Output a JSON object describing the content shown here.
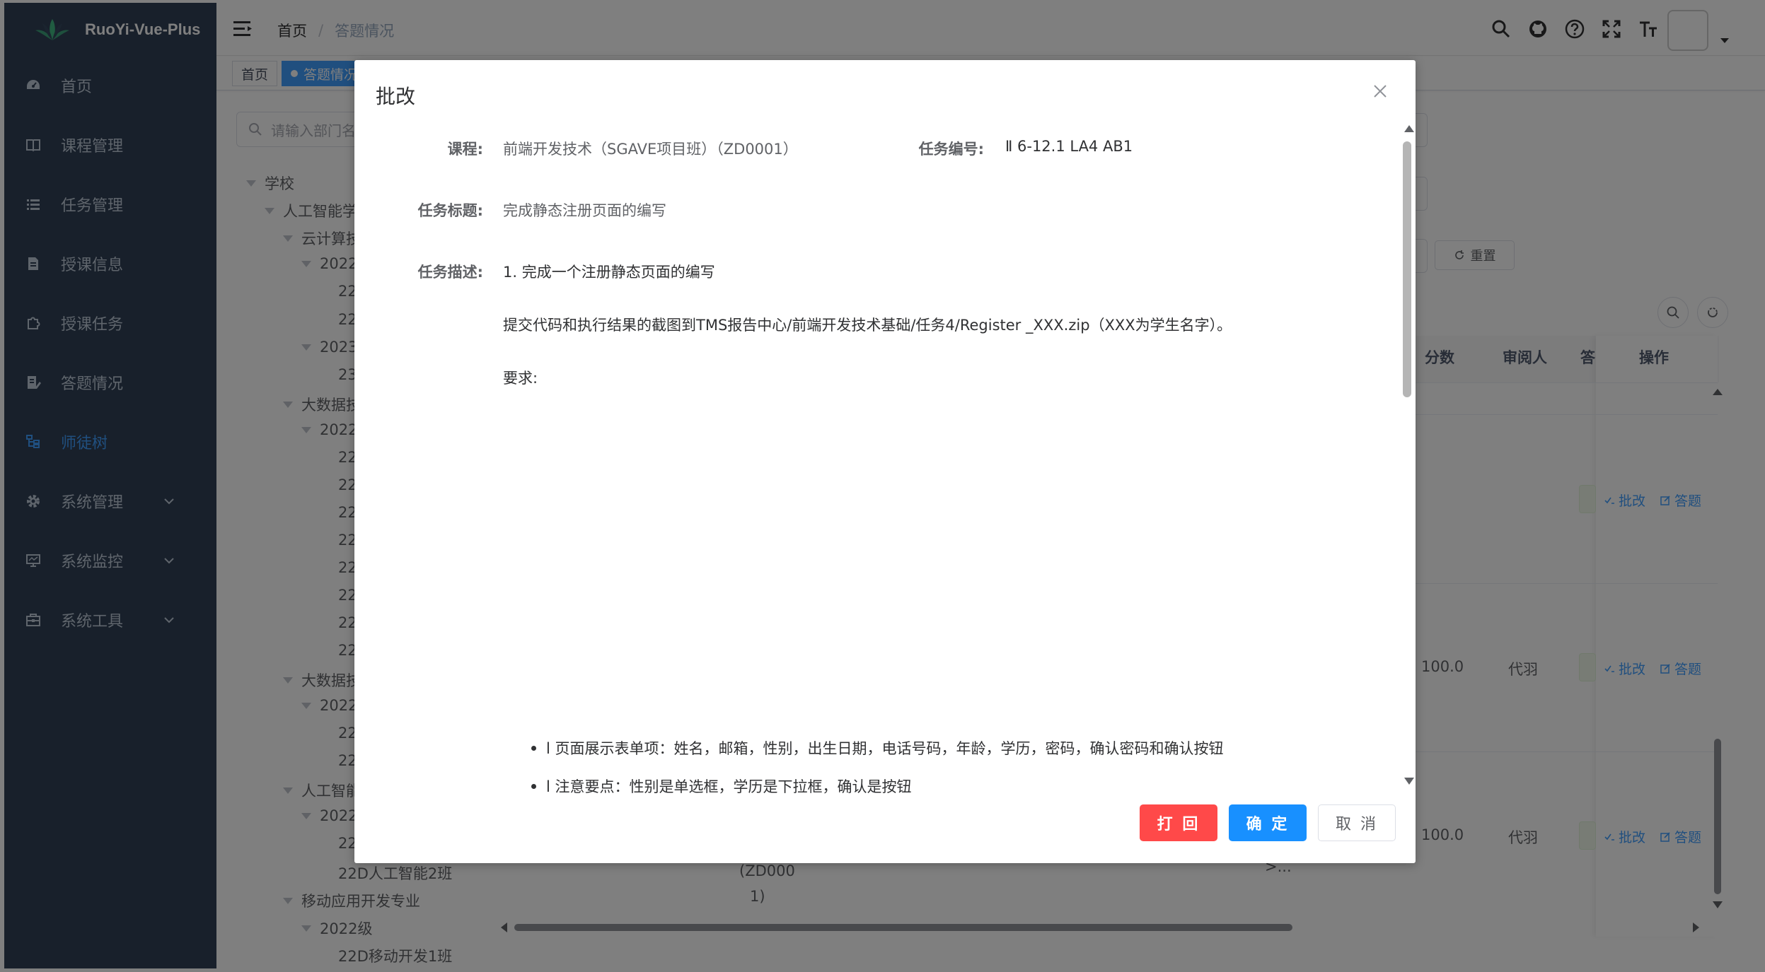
{
  "app": {
    "name": "RuoYi-Vue-Plus"
  },
  "sidebar": {
    "items": [
      {
        "label": "首页",
        "icon": "dashboard-icon"
      },
      {
        "label": "课程管理",
        "icon": "book-icon"
      },
      {
        "label": "任务管理",
        "icon": "list-icon"
      },
      {
        "label": "授课信息",
        "icon": "document-icon"
      },
      {
        "label": "授课任务",
        "icon": "puzzle-icon"
      },
      {
        "label": "答题情况",
        "icon": "edit-doc-icon"
      },
      {
        "label": "师徒树",
        "icon": "tree-icon",
        "active": true
      },
      {
        "label": "系统管理",
        "icon": "gear-icon",
        "expandable": true
      },
      {
        "label": "系统监控",
        "icon": "monitor-icon",
        "expandable": true
      },
      {
        "label": "系统工具",
        "icon": "toolbox-icon",
        "expandable": true
      }
    ]
  },
  "navbar": {
    "breadcrumb_home": "首页",
    "breadcrumb_sep": "/",
    "breadcrumb_current": "答题情况"
  },
  "tags": {
    "first": "首页",
    "active": "答题情况"
  },
  "background": {
    "tree_search_placeholder": "请输入部门名",
    "tree": [
      "学校",
      "人工智能学",
      "云计算技",
      "2022",
      "22",
      "22",
      "2023",
      "23",
      "大数据技",
      "2022",
      "22",
      "22",
      "22",
      "22",
      "22",
      "22",
      "22",
      "22",
      "大数据技",
      "2022",
      "22",
      "22",
      "人工智能",
      "2022",
      "22",
      "22D人工智能2班",
      "移动应用开发专业",
      "2022级",
      "22D移动开发1班"
    ],
    "reset_label": "重置",
    "table_headers": {
      "score": "分数",
      "reviewer": "审阅人",
      "answer": "答",
      "operation": "操作"
    },
    "rows": [
      {
        "score": "",
        "reviewer": ""
      },
      {
        "score": "100.0",
        "reviewer": "代羽"
      },
      {
        "score": "100.0",
        "reviewer": "代羽"
      }
    ],
    "op_review": "批改",
    "op_answer": "答题",
    "stray_a": "(ZD000",
    "stray_b": "1)",
    "stray_c": ">..."
  },
  "dialog": {
    "title": "批改",
    "course_label": "课程:",
    "course_value": "前端开发技术（SGAVE项目班）（ZD0001）",
    "task_no_label": "任务编号:",
    "task_no_value": "Ⅱ 6-12.1 LA4 AB1",
    "task_title_label": "任务标题:",
    "task_title_value": "完成静态注册页面的编写",
    "task_desc_label": "任务描述:",
    "desc_line1": "1. 完成一个注册静态页面的编写",
    "desc_line2": "提交代码和执行结果的截图到TMS报告中心/前端开发技术基础/任务4/Register _XXX.zip（XXX为学生名字）。",
    "desc_line3": "要求:",
    "bullet1": "l 页面展示表单项：姓名，邮箱，性别，出生日期，电话号码，年龄，学历，密码，确认密码和确认按钮",
    "bullet2": "l 注意要点：性别是单选框，学历是下拉框，确认是按钮",
    "reject_label": "打 回",
    "ok_label": "确 定",
    "cancel_label": "取 消"
  },
  "colors": {
    "sidebar_bg": "#304156",
    "primary": "#409eff",
    "danger": "#ff4949",
    "ok": "#1890ff"
  }
}
